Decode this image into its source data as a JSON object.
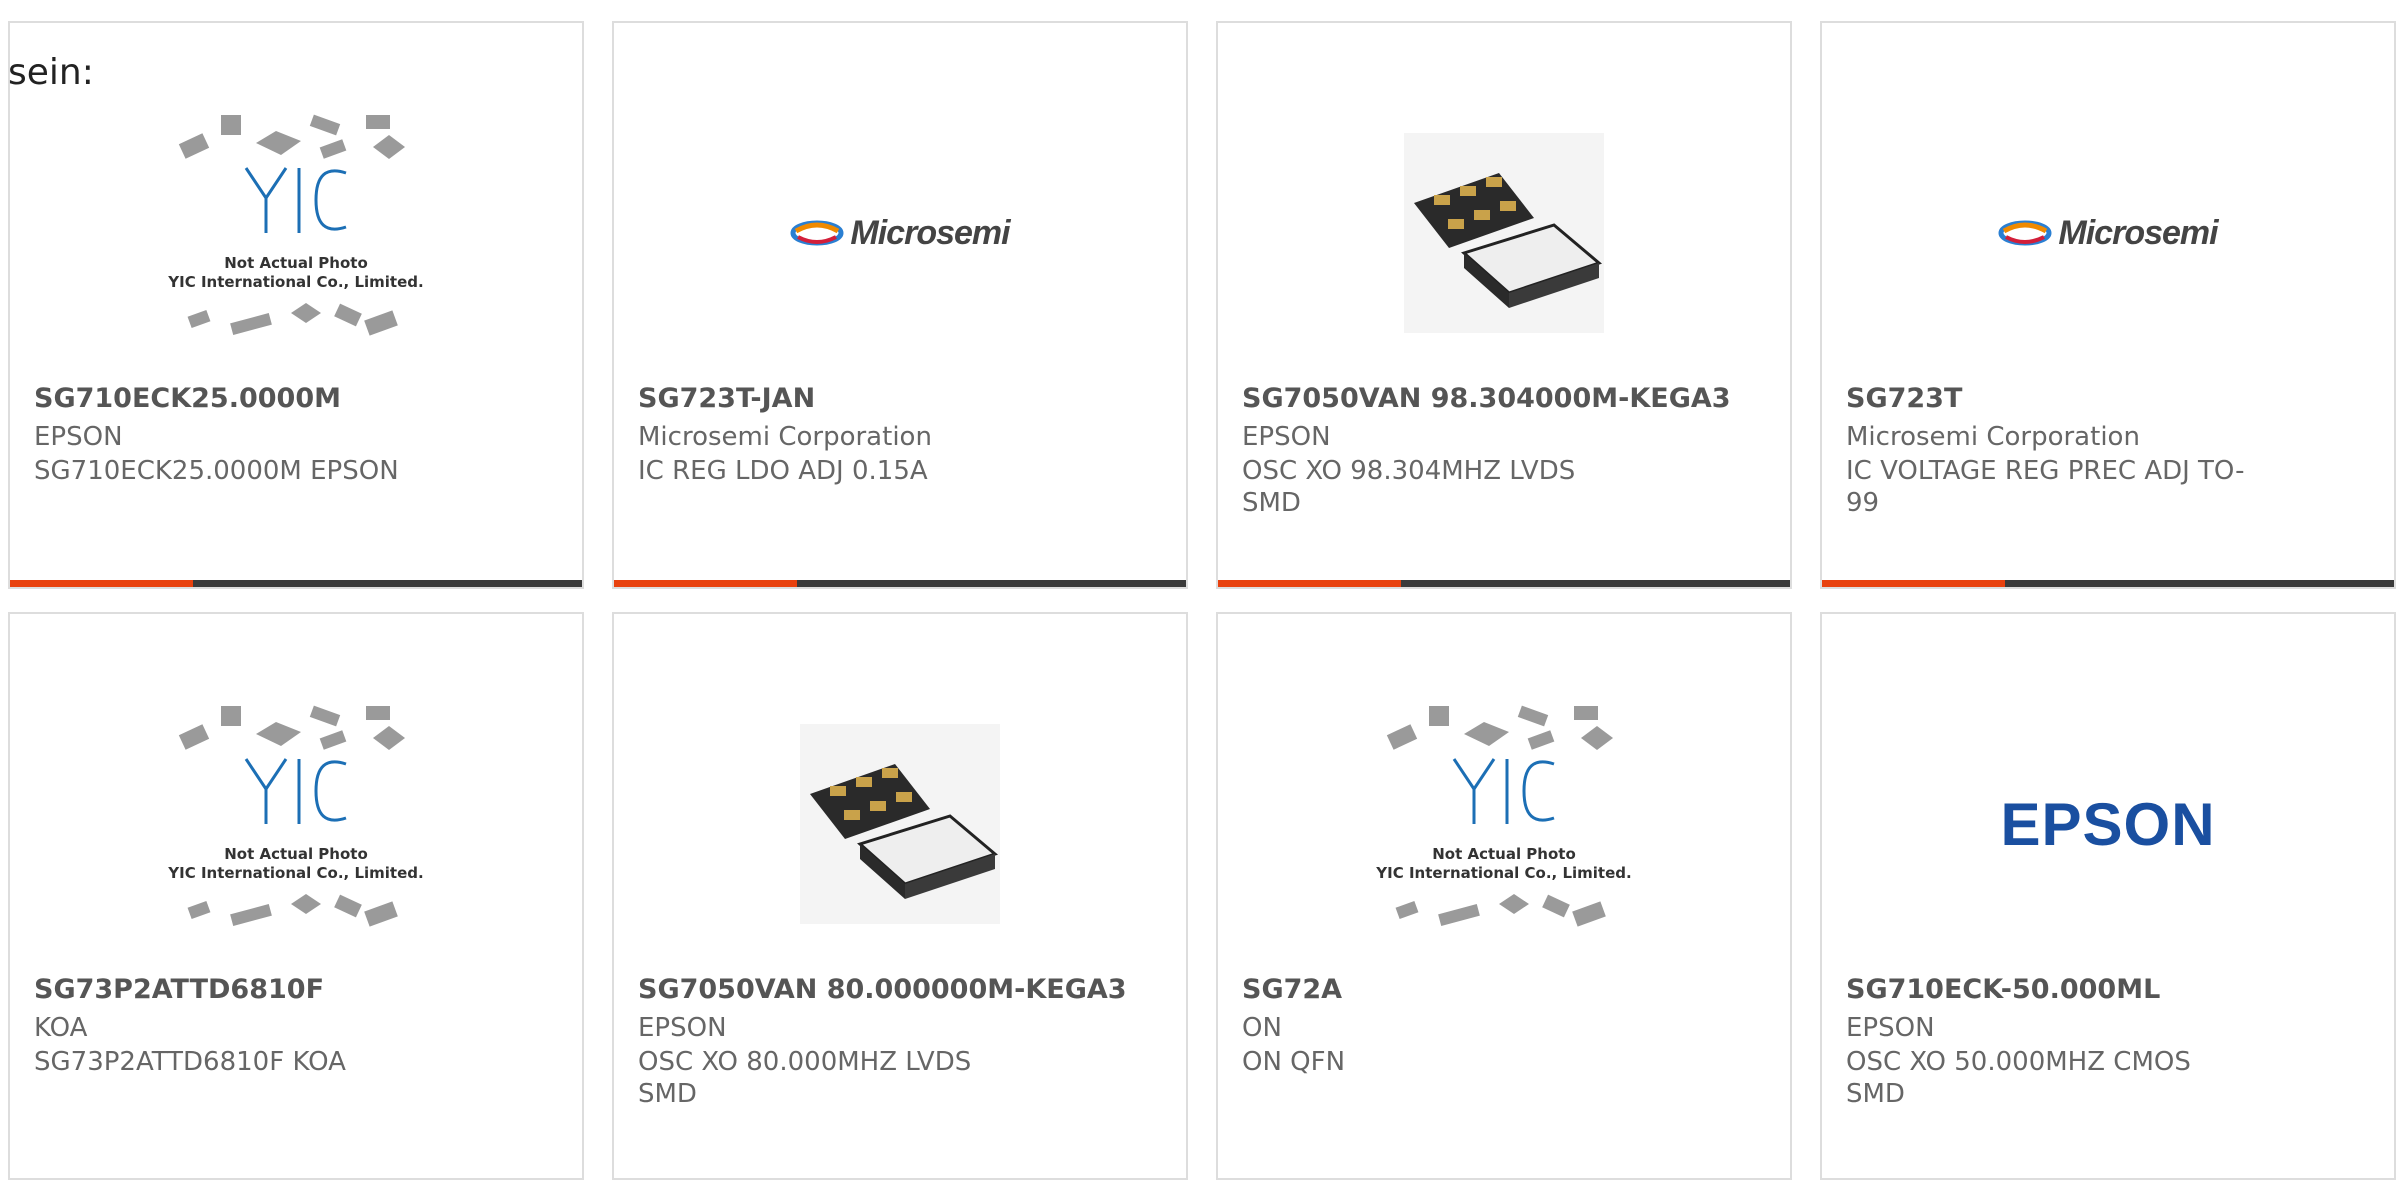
{
  "header": {
    "prefix_text": "sein:"
  },
  "colors": {
    "accent": "#e8410e",
    "bar": "#3a3a3a",
    "epson_blue": "#1a4fa0"
  },
  "products": [
    {
      "name": "SG710ECK25.0000M",
      "brand": "EPSON",
      "desc": "SG710ECK25.0000M EPSON",
      "image": "yic-placeholder",
      "image_text_1": "Not Actual Photo",
      "image_text_2": "YIC International Co., Limited."
    },
    {
      "name": "SG723T-JAN",
      "brand": "Microsemi Corporation",
      "desc": "IC REG LDO ADJ 0.15A",
      "image": "microsemi-logo",
      "logo_text": "Microsemi"
    },
    {
      "name": "SG7050VAN 98.304000M-KEGA3",
      "brand": "EPSON",
      "desc": "OSC XO 98.304MHZ LVDS SMD",
      "image": "oscillator-chip"
    },
    {
      "name": "SG723T",
      "brand": "Microsemi Corporation",
      "desc": "IC VOLTAGE REG PREC ADJ TO-99",
      "image": "microsemi-logo",
      "logo_text": "Microsemi"
    },
    {
      "name": "SG73P2ATTD6810F",
      "brand": "KOA",
      "desc": "SG73P2ATTD6810F KOA",
      "image": "yic-placeholder",
      "image_text_1": "Not Actual Photo",
      "image_text_2": "YIC International Co., Limited."
    },
    {
      "name": "SG7050VAN 80.000000M-KEGA3",
      "brand": "EPSON",
      "desc": "OSC XO 80.000MHZ LVDS SMD",
      "image": "oscillator-chip"
    },
    {
      "name": "SG72A",
      "brand": "ON",
      "desc": "ON QFN",
      "image": "yic-placeholder",
      "image_text_1": "Not Actual Photo",
      "image_text_2": "YIC International Co., Limited."
    },
    {
      "name": "SG710ECK-50.000ML",
      "brand": "EPSON",
      "desc": "OSC XO 50.000MHZ CMOS SMD",
      "image": "epson-logo",
      "logo_text": "EPSON"
    }
  ]
}
